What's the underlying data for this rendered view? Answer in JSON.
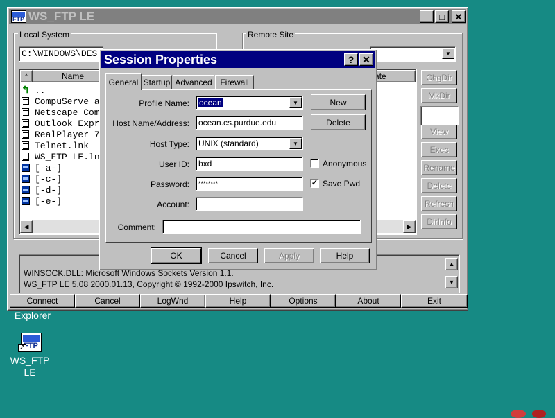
{
  "main_window": {
    "title": "WS_FTP LE",
    "local_label": "Local System",
    "local_path": "C:\\WINDOWS\\DES",
    "name_header": "Name",
    "local_files": [
      {
        "name": "..",
        "icon": "up-folder-icon"
      },
      {
        "name": "CompuServe a",
        "icon": "file-icon"
      },
      {
        "name": "Netscape Com",
        "icon": "file-icon"
      },
      {
        "name": "Outlook Expr",
        "icon": "file-icon"
      },
      {
        "name": "RealPlayer 7",
        "icon": "file-icon"
      },
      {
        "name": "Telnet.lnk",
        "icon": "file-icon"
      },
      {
        "name": "WS_FTP LE.ln",
        "icon": "file-icon"
      },
      {
        "name": "[-a-]",
        "icon": "drive-icon"
      },
      {
        "name": "[-c-]",
        "icon": "drive-icon"
      },
      {
        "name": "[-d-]",
        "icon": "drive-icon"
      },
      {
        "name": "[-e-]",
        "icon": "drive-icon"
      }
    ],
    "remote_label": "Remote Site",
    "remote_date_header": "ate",
    "remote_buttons": [
      "ChgDir",
      "MkDir",
      "View",
      "Exec",
      "Rename",
      "Delete",
      "Refresh",
      "DirInfo"
    ],
    "log_lines": [
      "WINSOCK.DLL: Microsoft Windows Sockets Version 1.1.",
      "WS_FTP LE 5.08 2000.01.13, Copyright © 1992-2000 Ipswitch, Inc."
    ],
    "bottom_buttons": [
      "Connect",
      "Cancel",
      "LogWnd",
      "Help",
      "Options",
      "About",
      "Exit"
    ]
  },
  "dialog": {
    "title": "Session Properties",
    "tabs": [
      "General",
      "Startup",
      "Advanced",
      "Firewall"
    ],
    "profile_name_label": "Profile Name:",
    "profile_name_value": "ocean",
    "host_label": "Host Name/Address:",
    "host_value": "ocean.cs.purdue.edu",
    "host_type_label": "Host Type:",
    "host_type_value": "UNIX (standard)",
    "user_id_label": "User ID:",
    "user_id_value": "bxd",
    "password_label": "Password:",
    "password_value": "********",
    "account_label": "Account:",
    "account_value": "",
    "comment_label": "Comment:",
    "comment_value": "",
    "new_label": "New",
    "delete_label": "Delete",
    "anonymous_label": "Anonymous",
    "anonymous_checked": false,
    "save_pwd_label": "Save Pwd",
    "save_pwd_checked": true,
    "ok_label": "OK",
    "cancel_label": "Cancel",
    "apply_label": "Apply",
    "help_label": "Help"
  },
  "desktop": {
    "explorer_label": "Explorer",
    "wsftp_icon_label_line1": "WS_FTP",
    "wsftp_icon_label_line2": "LE",
    "ftp_logo_text": "FTP"
  },
  "colors": {
    "desktop": "#168a84",
    "title_active": "#000080",
    "title_inactive": "#808080",
    "window_face": "#c0c0c0"
  }
}
